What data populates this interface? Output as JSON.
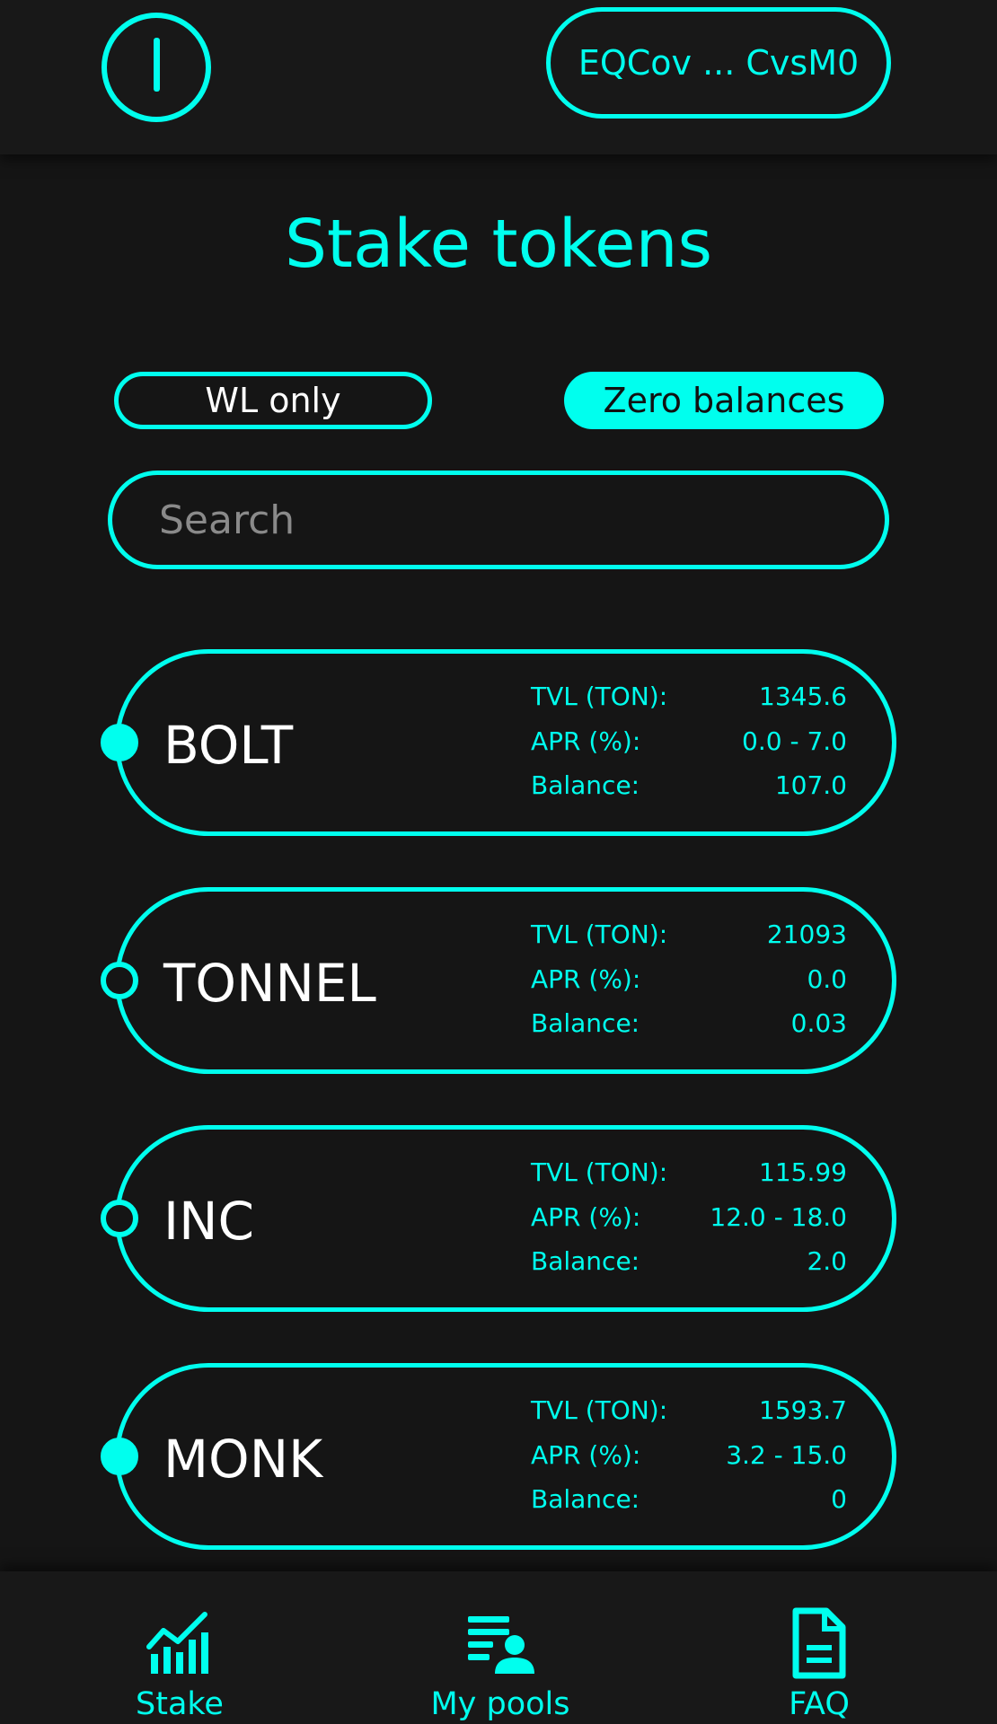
{
  "header": {
    "power_icon": "power-icon",
    "wallet_address": "EQCov ... CvsM0"
  },
  "page_title": "Stake tokens",
  "filters": {
    "wl_only": {
      "label": "WL only",
      "active": false
    },
    "zero_balances": {
      "label": "Zero balances",
      "active": true
    }
  },
  "search": {
    "placeholder": "Search",
    "value": ""
  },
  "stat_labels": {
    "tvl": "TVL (TON):",
    "apr": "APR (%):",
    "balance": "Balance:"
  },
  "tokens": [
    {
      "name": "BOLT",
      "selected": true,
      "tvl": "1345.6",
      "apr": "0.0 - 7.0",
      "balance": "107.0"
    },
    {
      "name": "TONNEL",
      "selected": false,
      "tvl": "21093",
      "apr": "0.0",
      "balance": "0.03"
    },
    {
      "name": "INC",
      "selected": false,
      "tvl": "115.99",
      "apr": "12.0 - 18.0",
      "balance": "2.0"
    },
    {
      "name": "MONK",
      "selected": true,
      "tvl": "1593.7",
      "apr": "3.2 - 15.0",
      "balance": "0"
    }
  ],
  "bottom_nav": [
    {
      "label": "Stake",
      "icon": "chart-icon"
    },
    {
      "label": "My pools",
      "icon": "user-list-icon"
    },
    {
      "label": "FAQ",
      "icon": "document-icon"
    }
  ],
  "colors": {
    "accent": "#00ffee",
    "background": "#151515",
    "bar": "#181818",
    "text": "#ffffff"
  }
}
